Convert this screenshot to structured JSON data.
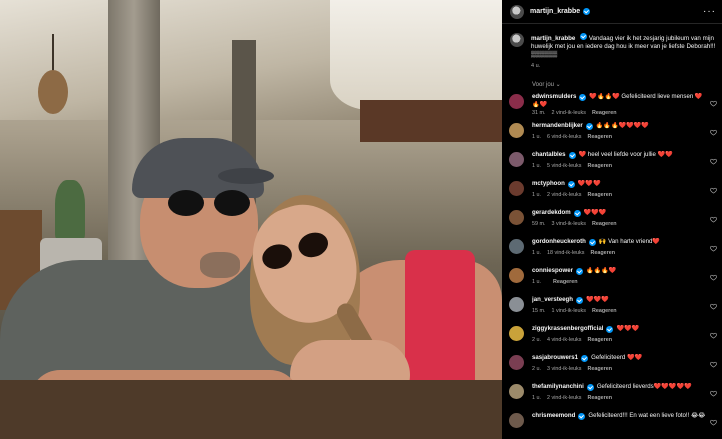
{
  "post_author": {
    "username": "martijn_krabbe"
  },
  "caption": {
    "username": "martijn_krabbe",
    "text": "Vandaag vier ik het zesjarig jubileum van mijn huwelijk met jou en iedere dag hou ik meer van je liefste Deborah!!! ▒▒▒▒▒▒",
    "time": "4 u."
  },
  "seen_by_label": "Voor jou ⌄",
  "comments": [
    {
      "user": "edwinsmulders",
      "text": "❤️🔥🔥❤️ Gefeliciteerd lieve mensen ❤️",
      "text2": "🔥❤️",
      "time": "31 m.",
      "likes": "2 vind-ik-leuks",
      "reply": "Reageren",
      "avatar_color": "#8a2d4a"
    },
    {
      "user": "hermandenblijker",
      "text": "🔥🔥🔥❤️❤️❤️❤️",
      "time": "1 u.",
      "likes": "6 vind-ik-leuks",
      "reply": "Reageren",
      "avatar_color": "#b08a52"
    },
    {
      "user": "chantalbles",
      "text": "❤️ heel veel liefde voor jullie ❤️❤️",
      "time": "1 u.",
      "likes": "5 vind-ik-leuks",
      "reply": "Reageren",
      "avatar_color": "#7c5a6b"
    },
    {
      "user": "mctyphoon",
      "text": "❤️❤️❤️",
      "time": "1 u.",
      "likes": "2 vind-ik-leuks",
      "reply": "Reageren",
      "avatar_color": "#6b3b2e"
    },
    {
      "user": "gerardekdom",
      "text": "❤️❤️❤️",
      "time": "59 m.",
      "likes": "3 vind-ik-leuks",
      "reply": "Reageren",
      "avatar_color": "#7a5236"
    },
    {
      "user": "gordonheuckeroth",
      "text": "🙌 Van harte vriend❤️",
      "time": "1 u.",
      "likes": "18 vind-ik-leuks",
      "reply": "Reageren",
      "avatar_color": "#5d6a73"
    },
    {
      "user": "conniespower",
      "text": "🔥🔥🔥❤️",
      "time": "1 u.",
      "likes": "",
      "reply": "Reageren",
      "avatar_color": "#a06a3c"
    },
    {
      "user": "jan_versteegh",
      "text": "❤️❤️❤️",
      "time": "15 m.",
      "likes": "1 vind-ik-leuks",
      "reply": "Reageren",
      "avatar_color": "#8a8f95"
    },
    {
      "user": "ziggykrassenbergofficial",
      "text": "❤️❤️❤️",
      "time": "2 u.",
      "likes": "4 vind-ik-leuks",
      "reply": "Reageren",
      "avatar_color": "#c9a23a"
    },
    {
      "user": "sasjabrouwers1",
      "text": "Gefeliciteerd ❤️❤️",
      "time": "2 u.",
      "likes": "3 vind-ik-leuks",
      "reply": "Reageren",
      "avatar_color": "#7a3e52"
    },
    {
      "user": "thefamilynanchini",
      "text": "Gefeliciteerd lieverds❤️❤️❤️❤️❤️",
      "time": "1 u.",
      "likes": "2 vind-ik-leuks",
      "reply": "Reageren",
      "avatar_color": "#9c8a6a"
    },
    {
      "user": "chrismeemond",
      "text": "Gefeliciteerd!!! En wat een lieve foto!! 😂😂",
      "time": "",
      "likes": "",
      "reply": "",
      "avatar_color": "#6e5a4c"
    }
  ],
  "colors": {
    "background": "#000000",
    "verified": "#0095f6",
    "muted_text": "#a8a8a8",
    "text": "#f5f5f5"
  },
  "icons": {
    "more": "more-icon",
    "heart": "heart-icon",
    "verified": "verified-badge-icon"
  }
}
